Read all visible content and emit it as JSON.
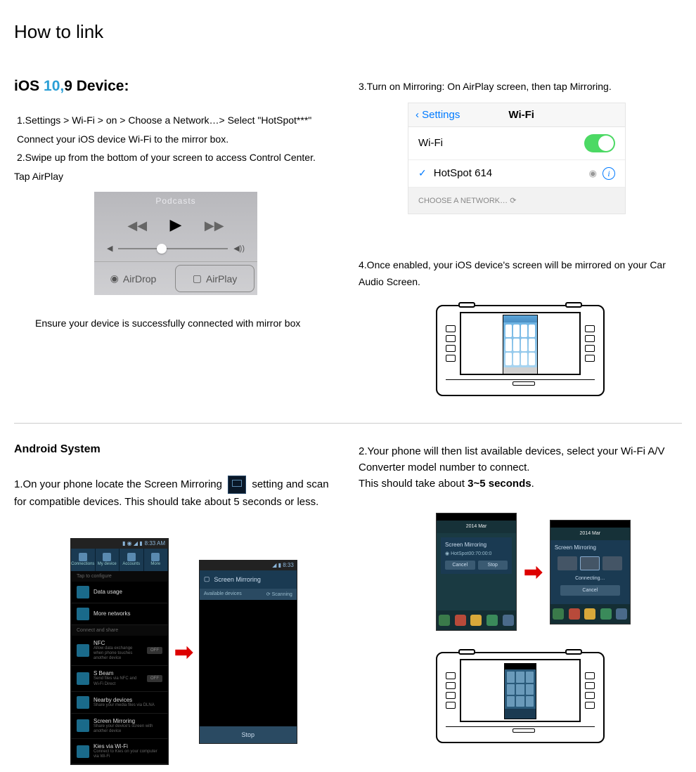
{
  "title": "How to link",
  "ios": {
    "heading_pre": "iOS ",
    "heading_blue": "10,",
    "heading_post": "9 Device:",
    "step1": "1.Settings > Wi-Fi > on > Choose a Network…> Select \"HotSpot***\"",
    "step1b": "Connect your iOS device Wi-Fi to the mirror box.",
    "step2": "2.Swipe up from the bottom of your screen to access Control Center.",
    "step2b": "Tap AirPlay",
    "ensure": "Ensure your device is successfully connected with mirror box",
    "step3": "3.Turn on Mirroring: On AirPlay screen, then tap Mirroring.",
    "step4": "4.Once enabled, your iOS device's screen will be mirrored on your Car Audio Screen.",
    "wifi": {
      "back": "Settings",
      "title": "Wi-Fi",
      "wifi_label": "Wi-Fi",
      "network": "HotSpot 614",
      "choose": "CHOOSE A NETWORK…"
    },
    "cc": {
      "podcasts": "Podcasts",
      "airdrop": "AirDrop",
      "airplay": "AirPlay"
    }
  },
  "android": {
    "heading": "Android System",
    "step1_a": "1.On your phone locate the Screen Mirroring ",
    "step1_b": " setting and scan for compatible devices. This should take about  5  seconds or less.",
    "step2": "2.Your phone will then list available devices, select your Wi-Fi A/V Converter model number to connect.",
    "step2b": "This should take about 3~5 seconds.",
    "bold_time": "3~5 seconds",
    "phone1": {
      "time": "8:33 AM",
      "tabs": [
        "Connections",
        "My device",
        "Accounts",
        "More"
      ],
      "tap": "Tap to configure",
      "items": [
        {
          "t": "Data usage",
          "s": ""
        },
        {
          "t": "More networks",
          "s": ""
        }
      ],
      "sect": "Connect and share",
      "items2": [
        {
          "t": "NFC",
          "s": "Allow data exchange when phone touches another device",
          "sw": "OFF"
        },
        {
          "t": "S Beam",
          "s": "Send files via NFC and Wi-Fi Direct",
          "sw": "OFF"
        },
        {
          "t": "Nearby devices",
          "s": "Share your media files via DLNA"
        },
        {
          "t": "Screen Mirroring",
          "s": "Share your device's screen with another device"
        },
        {
          "t": "Kies via Wi-Fi",
          "s": "Connect to Kies on your computer via Wi-Fi"
        }
      ]
    },
    "phone2": {
      "title": "Screen Mirroring",
      "sub_l": "Available devices",
      "sub_r": "Scanning",
      "stop": "Stop"
    },
    "home": {
      "date": "2014 Mar",
      "ovl_title": "Screen Mirroring",
      "ovl_sub": "HotSpot00:70:00:0",
      "cancel": "Cancel",
      "stop": "Stop",
      "connecting": "Connecting…"
    }
  }
}
